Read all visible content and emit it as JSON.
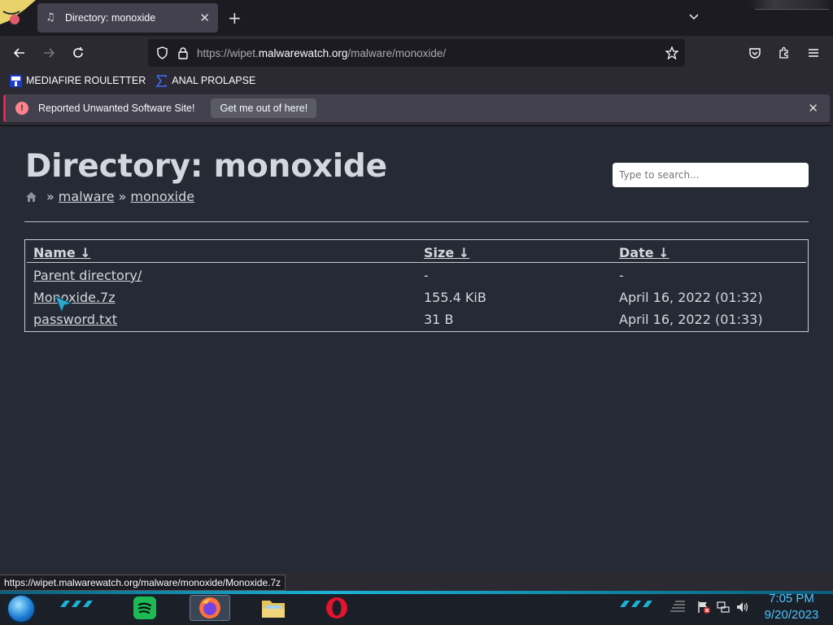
{
  "browser": {
    "tab_title": "Directory: monoxide",
    "url_prefix": "https://wipet.",
    "url_domain": "malwarewatch.org",
    "url_path": "/malware/monoxide/"
  },
  "bookmarks": [
    {
      "label": "MEDIAFIRE ROULETTER",
      "icon": "mft-icon"
    },
    {
      "label": "ANAL PROLAPSE",
      "icon": "sigma-icon"
    }
  ],
  "warning": {
    "message": "Reported Unwanted Software Site!",
    "button_label": "Get me out of here!"
  },
  "page": {
    "heading": "Directory: monoxide",
    "breadcrumb": [
      "malware",
      "monoxide"
    ],
    "breadcrumb_sep": "»",
    "search_placeholder": "Type to search...",
    "columns": {
      "name": "Name",
      "size": "Size",
      "date": "Date",
      "sort_arrow": "↓"
    },
    "rows": [
      {
        "name": "Parent directory/",
        "size": "-",
        "date": "-"
      },
      {
        "name": "Monoxide.7z",
        "size": "155.4 KiB",
        "date": "April 16, 2022 (01:32)"
      },
      {
        "name": "password.txt",
        "size": "31 B",
        "date": "April 16, 2022 (01:33)"
      }
    ]
  },
  "status_url": "https://wipet.malwarewatch.org/malware/monoxide/Monoxide.7z",
  "taskbar": {
    "time": "7:05 PM",
    "date": "9/20/2023"
  }
}
